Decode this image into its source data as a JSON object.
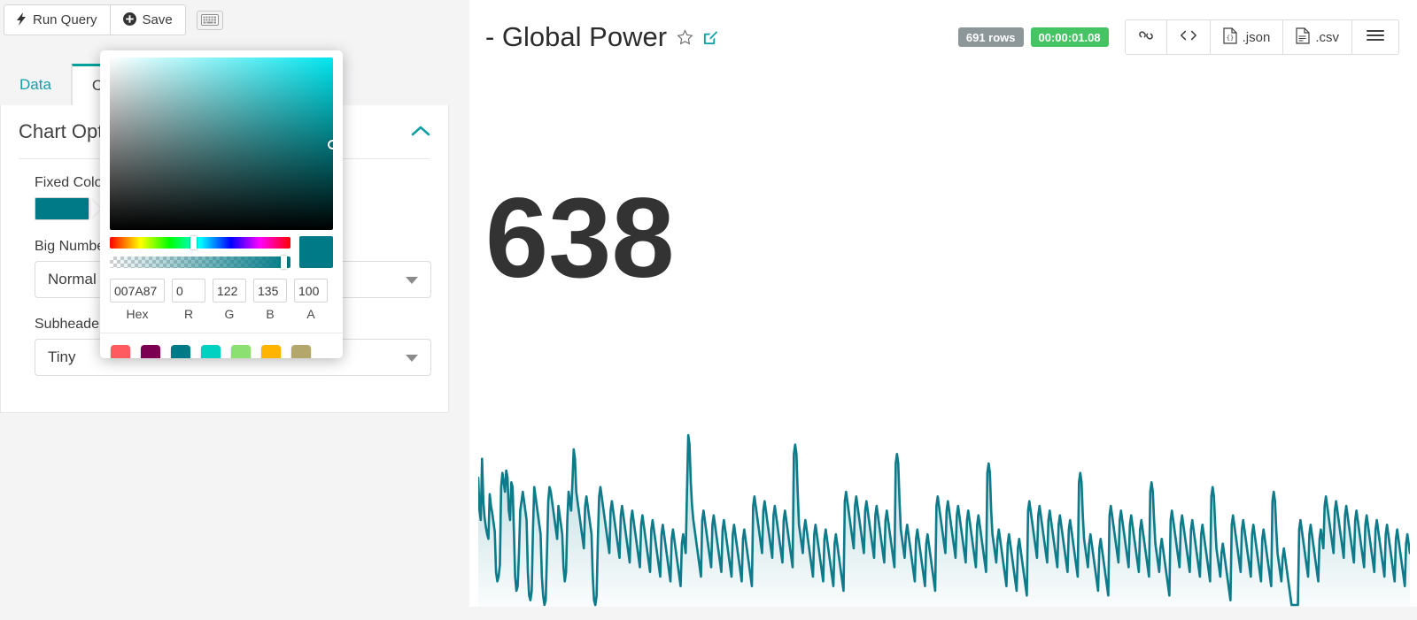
{
  "toolbar": {
    "run_query_label": "Run Query",
    "save_label": "Save",
    "run_icon": "lightning-bolt-icon",
    "save_icon": "plus-circle-icon",
    "keyboard_icon": "keyboard-icon"
  },
  "tabs": [
    {
      "label": "Data",
      "active": false
    },
    {
      "label": "Chart",
      "active": true
    }
  ],
  "chart_options": {
    "title": "Chart Options",
    "collapse_icon": "chevron-up-icon",
    "fields": [
      {
        "label": "Fixed Color",
        "type": "color",
        "value": "#007A87"
      },
      {
        "label": "Big Number Size",
        "type": "select",
        "value": "Normal"
      },
      {
        "label": "Subheader Size",
        "type": "select",
        "value": "Tiny"
      }
    ]
  },
  "color_picker": {
    "hex_value": "007A87",
    "r_value": "0",
    "g_value": "122",
    "b_value": "135",
    "a_value": "100",
    "hex_label": "Hex",
    "r_label": "R",
    "g_label": "G",
    "b_label": "B",
    "a_label": "A",
    "hue_position_pct": 46,
    "alpha_position_pct": 96,
    "preview_color": "#007A87",
    "swatches": [
      "#FF5A5F",
      "#7B0051",
      "#007A87",
      "#00D1C1",
      "#8CE071",
      "#FFB400",
      "#B4A76C"
    ]
  },
  "result_panel": {
    "title": "- Global Power",
    "favorite_icon": "star-icon",
    "edit_icon": "edit-pencil-icon",
    "badges": {
      "rows": "691 rows",
      "duration": "00:00:01.08"
    },
    "actions": [
      {
        "label": "",
        "icon": "link-chain-icon"
      },
      {
        "label": "",
        "icon": "code-brackets-icon"
      },
      {
        "label": ".json",
        "icon": "file-json-icon"
      },
      {
        "label": ".csv",
        "icon": "file-csv-icon"
      },
      {
        "label": "",
        "icon": "hamburger-menu-icon"
      }
    ],
    "big_number": "638"
  },
  "chart_data": {
    "type": "area",
    "title": "- Global Power",
    "series_name": "Global Power",
    "line_color": "#0d7b8a",
    "fill_color": "#0d7b8a",
    "point_count": 691,
    "xlabel": "",
    "ylabel": "",
    "values": [
      62,
      48,
      44,
      70,
      52,
      45,
      41,
      38,
      36,
      55,
      50,
      47,
      43,
      39,
      22,
      18,
      20,
      25,
      58,
      64,
      60,
      56,
      65,
      62,
      48,
      44,
      60,
      58,
      40,
      20,
      14,
      16,
      30,
      48,
      52,
      56,
      52,
      48,
      44,
      22,
      12,
      10,
      14,
      40,
      58,
      54,
      50,
      46,
      42,
      38,
      20,
      12,
      8,
      10,
      30,
      52,
      58,
      56,
      52,
      48,
      44,
      40,
      36,
      50,
      46,
      42,
      38,
      24,
      18,
      22,
      44,
      56,
      52,
      48,
      60,
      74,
      70,
      56,
      52,
      48,
      44,
      40,
      36,
      32,
      50,
      54,
      50,
      46,
      42,
      38,
      20,
      10,
      8,
      12,
      36,
      54,
      58,
      54,
      50,
      46,
      42,
      38,
      34,
      30,
      48,
      52,
      48,
      44,
      40,
      36,
      32,
      28,
      46,
      50,
      46,
      42,
      38,
      34,
      30,
      26,
      44,
      48,
      44,
      40,
      36,
      32,
      28,
      24,
      42,
      46,
      42,
      38,
      34,
      30,
      26,
      22,
      40,
      44,
      40,
      36,
      32,
      28,
      24,
      20,
      38,
      42,
      38,
      34,
      30,
      26,
      22,
      18,
      36,
      40,
      36,
      32,
      28,
      24,
      20,
      16,
      34,
      38,
      34,
      30,
      56,
      80,
      76,
      60,
      50,
      44,
      40,
      36,
      32,
      28,
      24,
      20,
      44,
      48,
      44,
      40,
      36,
      32,
      28,
      24,
      42,
      46,
      42,
      38,
      34,
      30,
      26,
      22,
      40,
      44,
      40,
      36,
      32,
      28,
      24,
      20,
      38,
      42,
      38,
      34,
      30,
      26,
      22,
      18,
      36,
      40,
      36,
      32,
      28,
      24,
      20,
      16,
      50,
      54,
      50,
      46,
      42,
      38,
      34,
      30,
      48,
      52,
      48,
      44,
      40,
      36,
      32,
      28,
      46,
      50,
      46,
      42,
      38,
      34,
      30,
      26,
      44,
      48,
      44,
      40,
      36,
      32,
      28,
      24,
      72,
      76,
      72,
      56,
      42,
      38,
      34,
      30,
      40,
      44,
      40,
      36,
      32,
      28,
      24,
      20,
      38,
      42,
      38,
      34,
      30,
      26,
      22,
      18,
      36,
      40,
      36,
      32,
      28,
      24,
      20,
      16,
      34,
      38,
      34,
      30,
      26,
      22,
      18,
      14,
      52,
      56,
      52,
      48,
      44,
      40,
      36,
      32,
      50,
      54,
      50,
      46,
      42,
      38,
      34,
      30,
      48,
      52,
      48,
      44,
      40,
      36,
      32,
      28,
      46,
      50,
      46,
      42,
      38,
      34,
      30,
      26,
      44,
      48,
      44,
      40,
      36,
      32,
      28,
      24,
      68,
      72,
      68,
      52,
      40,
      36,
      32,
      28,
      38,
      42,
      38,
      34,
      30,
      26,
      22,
      18,
      36,
      40,
      36,
      32,
      28,
      24,
      20,
      16,
      34,
      38,
      34,
      30,
      26,
      22,
      18,
      14,
      50,
      54,
      50,
      46,
      42,
      38,
      34,
      30,
      48,
      52,
      48,
      44,
      40,
      36,
      32,
      28,
      46,
      50,
      46,
      42,
      38,
      34,
      30,
      26,
      44,
      48,
      44,
      40,
      36,
      32,
      28,
      24,
      42,
      46,
      42,
      38,
      34,
      30,
      26,
      22,
      64,
      68,
      64,
      48,
      38,
      34,
      30,
      26,
      36,
      40,
      36,
      32,
      28,
      24,
      20,
      16,
      34,
      38,
      34,
      30,
      26,
      22,
      18,
      14,
      32,
      36,
      32,
      28,
      24,
      20,
      16,
      12,
      48,
      52,
      48,
      44,
      40,
      36,
      32,
      28,
      46,
      50,
      46,
      42,
      38,
      34,
      30,
      26,
      44,
      48,
      44,
      40,
      36,
      32,
      28,
      24,
      42,
      46,
      42,
      38,
      34,
      30,
      26,
      22,
      40,
      44,
      40,
      36,
      32,
      28,
      24,
      20,
      60,
      64,
      60,
      46,
      36,
      32,
      28,
      24,
      34,
      38,
      34,
      30,
      26,
      22,
      18,
      14,
      32,
      36,
      32,
      28,
      24,
      20,
      16,
      12,
      46,
      50,
      46,
      42,
      38,
      34,
      30,
      26,
      44,
      48,
      44,
      40,
      36,
      32,
      28,
      24,
      42,
      46,
      42,
      38,
      34,
      30,
      26,
      22,
      40,
      44,
      40,
      36,
      32,
      28,
      24,
      20,
      56,
      60,
      56,
      44,
      34,
      30,
      26,
      22,
      32,
      36,
      32,
      28,
      24,
      20,
      16,
      12,
      44,
      48,
      44,
      40,
      36,
      32,
      28,
      24,
      42,
      46,
      42,
      38,
      34,
      30,
      26,
      22,
      40,
      44,
      40,
      36,
      32,
      28,
      24,
      20,
      38,
      42,
      38,
      34,
      30,
      26,
      22,
      18,
      54,
      58,
      54,
      42,
      32,
      28,
      24,
      20,
      30,
      34,
      30,
      26,
      22,
      18,
      14,
      10,
      42,
      46,
      42,
      38,
      34,
      30,
      26,
      22,
      40,
      44,
      40,
      36,
      32,
      28,
      24,
      20,
      38,
      42,
      38,
      34,
      30,
      26,
      22,
      18,
      36,
      40,
      36,
      32,
      28,
      24,
      20,
      16,
      52,
      56,
      52,
      40,
      30,
      26,
      22,
      18,
      28,
      32,
      28,
      24,
      20,
      16,
      12,
      8,
      8,
      8,
      8,
      8,
      8,
      40,
      44,
      40,
      36,
      32,
      28,
      24,
      20,
      38,
      42,
      38,
      34,
      30,
      26,
      22,
      18,
      36,
      40,
      36,
      32,
      50,
      54,
      50,
      46,
      42,
      38,
      34,
      30,
      48,
      52,
      48,
      44,
      40,
      36,
      32,
      28,
      46,
      50,
      46,
      42,
      38,
      34,
      30,
      26,
      44,
      48,
      44,
      40,
      36,
      32,
      28,
      24,
      42,
      46,
      42,
      38,
      34,
      30,
      26,
      22,
      40,
      44,
      40,
      36,
      32,
      28,
      24,
      20,
      38,
      42,
      38,
      34,
      30,
      26,
      22,
      18,
      36,
      40,
      36,
      32,
      28,
      24,
      20,
      16,
      34,
      38,
      34,
      30
    ]
  }
}
